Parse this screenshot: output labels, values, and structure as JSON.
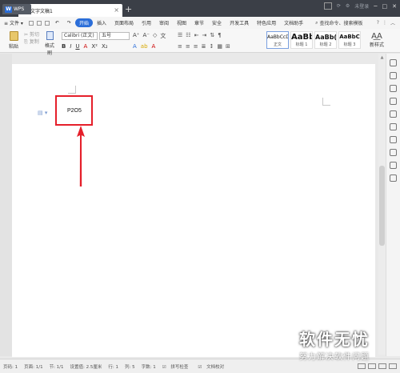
{
  "titlebar": {
    "app_tab": "WPS",
    "doc_tab": "文字文稿1",
    "new_tab": "+",
    "login": "未登录"
  },
  "menu": {
    "file": "文件",
    "items": [
      "开始",
      "插入",
      "页面布局",
      "引用",
      "审阅",
      "视图",
      "章节",
      "安全",
      "开发工具",
      "特色应用",
      "文档助手"
    ],
    "active_index": 0,
    "search": "查找命令、搜索模板",
    "help": "?"
  },
  "ribbon": {
    "paste": "粘贴",
    "cut": "剪切",
    "copy": "复制",
    "format_painter": "格式刷",
    "font_name": "Calibri (正文)",
    "font_size": "五号",
    "bold": "B",
    "italic": "I",
    "underline": "U",
    "styles": [
      {
        "sample": "AaBbCcDd",
        "name": "正文"
      },
      {
        "sample": "AaBb",
        "name": "标题 1"
      },
      {
        "sample": "AaBb(",
        "name": "标题 2"
      },
      {
        "sample": "AaBbC",
        "name": "标题 3"
      }
    ],
    "new_style": "新样式"
  },
  "document": {
    "content": "P2O5"
  },
  "statusbar": {
    "page": "页码: 1",
    "pages": "页面: 1/1",
    "section": "节: 1/1",
    "position": "设置值: 2.5厘米",
    "row": "行: 1",
    "col": "列: 5",
    "words": "字数: 1",
    "spell": "拼写检查",
    "proof": "文档校对"
  },
  "watermark": {
    "main": "软件无忧",
    "sub": "努力解决软件问题"
  },
  "colors": {
    "accent": "#2b6ed9",
    "highlight_box": "#e5202b",
    "arrow": "#e5202b"
  }
}
